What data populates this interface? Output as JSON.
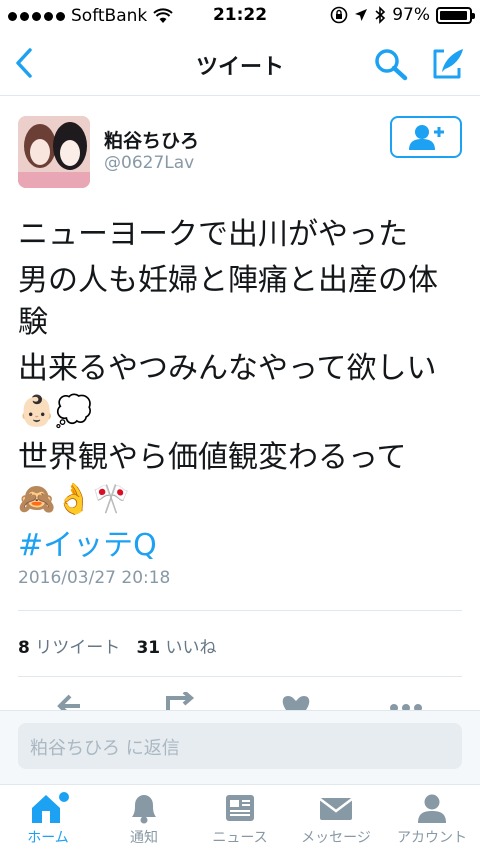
{
  "status_bar": {
    "carrier": "SoftBank",
    "time": "21:22",
    "battery": "97%",
    "battery_level": 0.97
  },
  "nav": {
    "title": "ツイート"
  },
  "tweet": {
    "name": "粕谷ちひろ",
    "handle": "@0627Lav",
    "lines": [
      "ニューヨークで出川がやった",
      "男の人も妊婦と陣痛と出産の体験",
      "出来るやつみんなやって欲しい",
      "世界観やら価値観変わるって"
    ],
    "emoji_line3": "👶🏻💭",
    "emoji_line4": "🙈👌🎌",
    "hashtag": "#イッテQ",
    "date": "2016/03/27 20:18",
    "retweets_count": "8",
    "retweets_label": "リツイート",
    "likes_count": "31",
    "likes_label": "いいね"
  },
  "reply": {
    "placeholder": "粕谷ちひろ に返信"
  },
  "tabs": [
    {
      "label": "ホーム",
      "icon": "home-icon",
      "active": true
    },
    {
      "label": "通知",
      "icon": "bell-icon"
    },
    {
      "label": "ニュース",
      "icon": "news-icon"
    },
    {
      "label": "メッセージ",
      "icon": "envelope-icon"
    },
    {
      "label": "アカウント",
      "icon": "person-icon"
    }
  ],
  "colors": {
    "accent": "#1da1f2",
    "text": "#14171a",
    "muted": "#8899a6"
  }
}
